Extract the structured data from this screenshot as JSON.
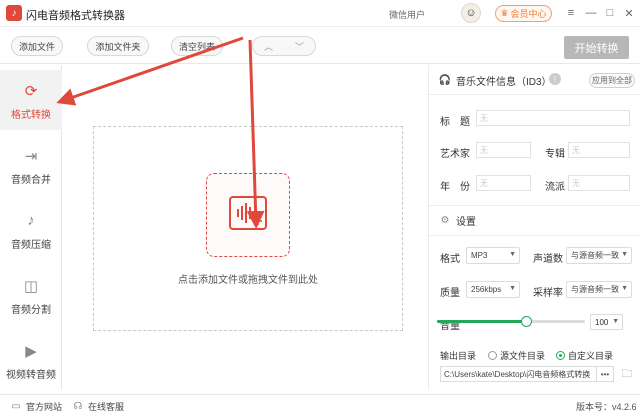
{
  "titlebar": {
    "app_title": "闪电音频格式转换器",
    "user_label": "微信用户",
    "member_label": "会员中心"
  },
  "toolbar": {
    "add_file": "添加文件",
    "add_folder": "添加文件夹",
    "clear_list": "清空列表",
    "start_convert": "开始转换"
  },
  "sidebar": {
    "items": [
      {
        "label": "格式转换",
        "icon": "refresh-icon"
      },
      {
        "label": "音频合并",
        "icon": "merge-icon"
      },
      {
        "label": "音频压缩",
        "icon": "compress-icon"
      },
      {
        "label": "音频分割",
        "icon": "split-icon"
      },
      {
        "label": "视频转音频",
        "icon": "video-icon"
      }
    ]
  },
  "dropzone": {
    "hint": "点击添加文件或拖拽文件到此处"
  },
  "id3": {
    "heading": "音乐文件信息（ID3）",
    "apply_all": "应用到全部",
    "title_label": "标　题",
    "artist_label": "艺术家",
    "album_label": "专辑",
    "year_label": "年　份",
    "genre_label": "流派",
    "placeholder": "无"
  },
  "settings": {
    "heading": "设置",
    "format_label": "格式",
    "format_value": "MP3",
    "channels_label": "声道数",
    "channels_value": "与源音频一致",
    "quality_label": "质量",
    "quality_value": "256kbps",
    "samplerate_label": "采样率",
    "samplerate_value": "与源音频一致",
    "volume_label": "音量",
    "volume_value": "100",
    "volume_level": 0.6,
    "output_label": "输出目录",
    "source_dir_label": "源文件目录",
    "custom_dir_label": "自定义目录",
    "output_path": "C:\\Users\\kate\\Desktop\\闪电音频格式转换",
    "browse_label": "•••"
  },
  "statusbar": {
    "website": "官方网站",
    "support": "在线客服",
    "version": "版本号：v4.2.6"
  },
  "colors": {
    "accent": "#e0483b",
    "green": "#26a65b"
  }
}
